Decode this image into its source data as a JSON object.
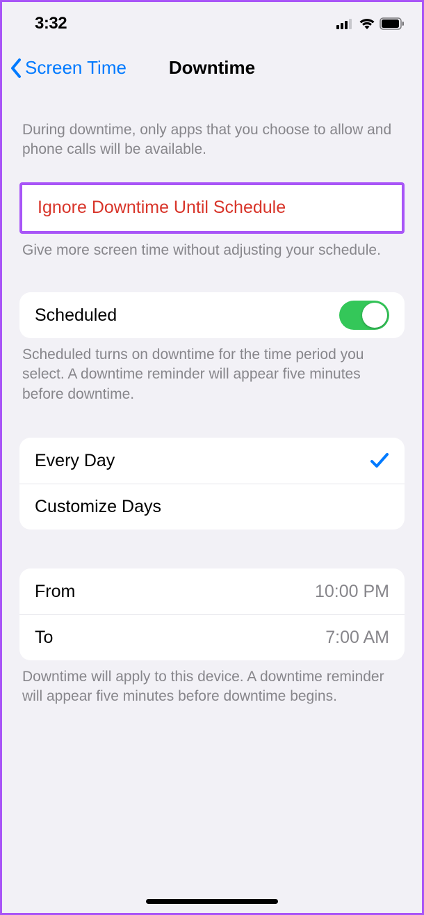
{
  "status": {
    "time": "3:32"
  },
  "nav": {
    "back_label": "Screen Time",
    "title": "Downtime"
  },
  "intro": "During downtime, only apps that you choose to allow and phone calls will be available.",
  "ignore": {
    "label": "Ignore Downtime Until Schedule",
    "footer": "Give more screen time without adjusting your schedule."
  },
  "scheduled": {
    "label": "Scheduled",
    "on": true,
    "footer": "Scheduled turns on downtime for the time period you select. A downtime reminder will appear five minutes before downtime."
  },
  "days": {
    "every_day": "Every Day",
    "every_day_selected": true,
    "customize": "Customize Days"
  },
  "time": {
    "from_label": "From",
    "from_value": "10:00 PM",
    "to_label": "To",
    "to_value": "7:00 AM",
    "footer": "Downtime will apply to this device. A downtime reminder will appear five minutes before downtime begins."
  }
}
